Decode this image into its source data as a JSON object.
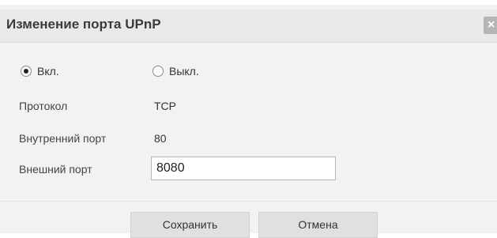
{
  "dialog": {
    "title": "Изменение порта UPnP",
    "close_glyph": "×"
  },
  "status": {
    "on_label": "Вкл.",
    "off_label": "Выкл.",
    "selected": "on"
  },
  "fields": {
    "protocol_label": "Протокол",
    "protocol_value": "TCP",
    "internal_port_label": "Внутренний порт",
    "internal_port_value": "80",
    "external_port_label": "Внешний порт",
    "external_port_value": "8080"
  },
  "buttons": {
    "save_label": "Сохранить",
    "cancel_label": "Отмена"
  }
}
